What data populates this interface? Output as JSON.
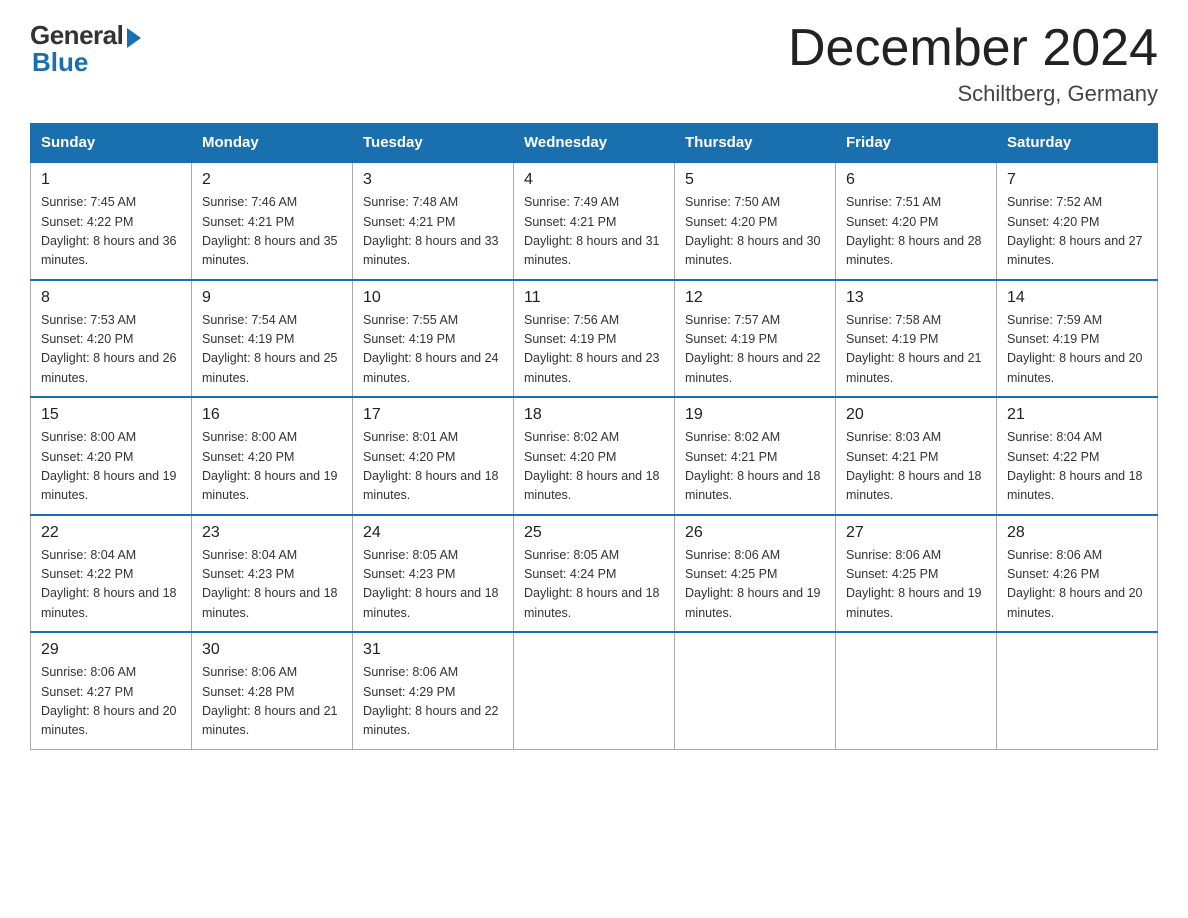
{
  "logo": {
    "general": "General",
    "blue": "Blue"
  },
  "title": {
    "month": "December 2024",
    "location": "Schiltberg, Germany"
  },
  "headers": [
    "Sunday",
    "Monday",
    "Tuesday",
    "Wednesday",
    "Thursday",
    "Friday",
    "Saturday"
  ],
  "weeks": [
    [
      {
        "day": "1",
        "sunrise": "Sunrise: 7:45 AM",
        "sunset": "Sunset: 4:22 PM",
        "daylight": "Daylight: 8 hours and 36 minutes."
      },
      {
        "day": "2",
        "sunrise": "Sunrise: 7:46 AM",
        "sunset": "Sunset: 4:21 PM",
        "daylight": "Daylight: 8 hours and 35 minutes."
      },
      {
        "day": "3",
        "sunrise": "Sunrise: 7:48 AM",
        "sunset": "Sunset: 4:21 PM",
        "daylight": "Daylight: 8 hours and 33 minutes."
      },
      {
        "day": "4",
        "sunrise": "Sunrise: 7:49 AM",
        "sunset": "Sunset: 4:21 PM",
        "daylight": "Daylight: 8 hours and 31 minutes."
      },
      {
        "day": "5",
        "sunrise": "Sunrise: 7:50 AM",
        "sunset": "Sunset: 4:20 PM",
        "daylight": "Daylight: 8 hours and 30 minutes."
      },
      {
        "day": "6",
        "sunrise": "Sunrise: 7:51 AM",
        "sunset": "Sunset: 4:20 PM",
        "daylight": "Daylight: 8 hours and 28 minutes."
      },
      {
        "day": "7",
        "sunrise": "Sunrise: 7:52 AM",
        "sunset": "Sunset: 4:20 PM",
        "daylight": "Daylight: 8 hours and 27 minutes."
      }
    ],
    [
      {
        "day": "8",
        "sunrise": "Sunrise: 7:53 AM",
        "sunset": "Sunset: 4:20 PM",
        "daylight": "Daylight: 8 hours and 26 minutes."
      },
      {
        "day": "9",
        "sunrise": "Sunrise: 7:54 AM",
        "sunset": "Sunset: 4:19 PM",
        "daylight": "Daylight: 8 hours and 25 minutes."
      },
      {
        "day": "10",
        "sunrise": "Sunrise: 7:55 AM",
        "sunset": "Sunset: 4:19 PM",
        "daylight": "Daylight: 8 hours and 24 minutes."
      },
      {
        "day": "11",
        "sunrise": "Sunrise: 7:56 AM",
        "sunset": "Sunset: 4:19 PM",
        "daylight": "Daylight: 8 hours and 23 minutes."
      },
      {
        "day": "12",
        "sunrise": "Sunrise: 7:57 AM",
        "sunset": "Sunset: 4:19 PM",
        "daylight": "Daylight: 8 hours and 22 minutes."
      },
      {
        "day": "13",
        "sunrise": "Sunrise: 7:58 AM",
        "sunset": "Sunset: 4:19 PM",
        "daylight": "Daylight: 8 hours and 21 minutes."
      },
      {
        "day": "14",
        "sunrise": "Sunrise: 7:59 AM",
        "sunset": "Sunset: 4:19 PM",
        "daylight": "Daylight: 8 hours and 20 minutes."
      }
    ],
    [
      {
        "day": "15",
        "sunrise": "Sunrise: 8:00 AM",
        "sunset": "Sunset: 4:20 PM",
        "daylight": "Daylight: 8 hours and 19 minutes."
      },
      {
        "day": "16",
        "sunrise": "Sunrise: 8:00 AM",
        "sunset": "Sunset: 4:20 PM",
        "daylight": "Daylight: 8 hours and 19 minutes."
      },
      {
        "day": "17",
        "sunrise": "Sunrise: 8:01 AM",
        "sunset": "Sunset: 4:20 PM",
        "daylight": "Daylight: 8 hours and 18 minutes."
      },
      {
        "day": "18",
        "sunrise": "Sunrise: 8:02 AM",
        "sunset": "Sunset: 4:20 PM",
        "daylight": "Daylight: 8 hours and 18 minutes."
      },
      {
        "day": "19",
        "sunrise": "Sunrise: 8:02 AM",
        "sunset": "Sunset: 4:21 PM",
        "daylight": "Daylight: 8 hours and 18 minutes."
      },
      {
        "day": "20",
        "sunrise": "Sunrise: 8:03 AM",
        "sunset": "Sunset: 4:21 PM",
        "daylight": "Daylight: 8 hours and 18 minutes."
      },
      {
        "day": "21",
        "sunrise": "Sunrise: 8:04 AM",
        "sunset": "Sunset: 4:22 PM",
        "daylight": "Daylight: 8 hours and 18 minutes."
      }
    ],
    [
      {
        "day": "22",
        "sunrise": "Sunrise: 8:04 AM",
        "sunset": "Sunset: 4:22 PM",
        "daylight": "Daylight: 8 hours and 18 minutes."
      },
      {
        "day": "23",
        "sunrise": "Sunrise: 8:04 AM",
        "sunset": "Sunset: 4:23 PM",
        "daylight": "Daylight: 8 hours and 18 minutes."
      },
      {
        "day": "24",
        "sunrise": "Sunrise: 8:05 AM",
        "sunset": "Sunset: 4:23 PM",
        "daylight": "Daylight: 8 hours and 18 minutes."
      },
      {
        "day": "25",
        "sunrise": "Sunrise: 8:05 AM",
        "sunset": "Sunset: 4:24 PM",
        "daylight": "Daylight: 8 hours and 18 minutes."
      },
      {
        "day": "26",
        "sunrise": "Sunrise: 8:06 AM",
        "sunset": "Sunset: 4:25 PM",
        "daylight": "Daylight: 8 hours and 19 minutes."
      },
      {
        "day": "27",
        "sunrise": "Sunrise: 8:06 AM",
        "sunset": "Sunset: 4:25 PM",
        "daylight": "Daylight: 8 hours and 19 minutes."
      },
      {
        "day": "28",
        "sunrise": "Sunrise: 8:06 AM",
        "sunset": "Sunset: 4:26 PM",
        "daylight": "Daylight: 8 hours and 20 minutes."
      }
    ],
    [
      {
        "day": "29",
        "sunrise": "Sunrise: 8:06 AM",
        "sunset": "Sunset: 4:27 PM",
        "daylight": "Daylight: 8 hours and 20 minutes."
      },
      {
        "day": "30",
        "sunrise": "Sunrise: 8:06 AM",
        "sunset": "Sunset: 4:28 PM",
        "daylight": "Daylight: 8 hours and 21 minutes."
      },
      {
        "day": "31",
        "sunrise": "Sunrise: 8:06 AM",
        "sunset": "Sunset: 4:29 PM",
        "daylight": "Daylight: 8 hours and 22 minutes."
      },
      null,
      null,
      null,
      null
    ]
  ]
}
